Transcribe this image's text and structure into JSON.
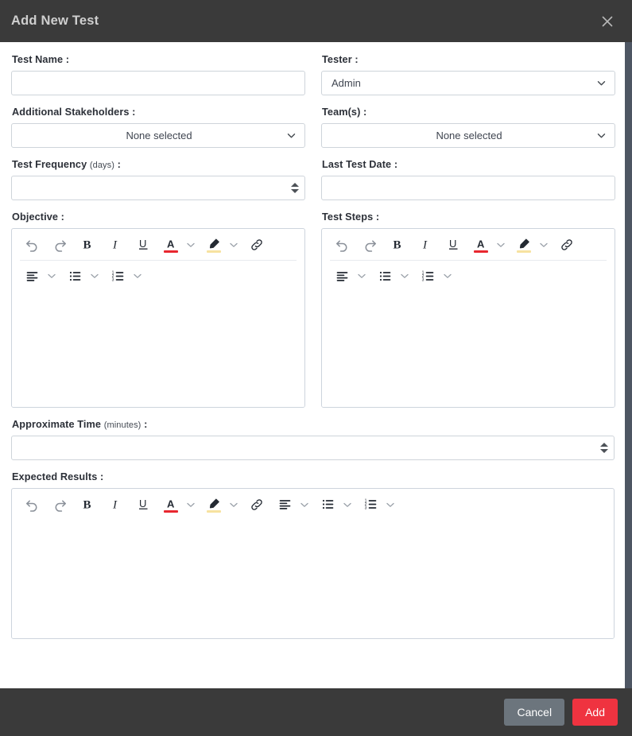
{
  "header": {
    "title": "Add New Test",
    "close_icon": "close-icon"
  },
  "form": {
    "test_name": {
      "label": "Test Name",
      "colon": ":",
      "value": "",
      "placeholder": ""
    },
    "tester": {
      "label": "Tester",
      "colon": ":",
      "selected": "Admin",
      "chevron_icon": "chevron-down-icon"
    },
    "additional_stakeholders": {
      "label": "Additional Stakeholders",
      "colon": ":",
      "selected": "None selected",
      "chevron_icon": "chevron-down-icon"
    },
    "teams": {
      "label": "Team(s)",
      "colon": ":",
      "selected": "None selected",
      "chevron_icon": "chevron-down-icon"
    },
    "test_frequency": {
      "label": "Test Frequency",
      "unit": "(days)",
      "colon": ":",
      "value": "",
      "spinner_icon": "number-spinner-icon"
    },
    "last_test_date": {
      "label": "Last Test Date",
      "colon": ":",
      "value": "",
      "placeholder": ""
    },
    "objective": {
      "label": "Objective",
      "colon": ":",
      "content": ""
    },
    "test_steps": {
      "label": "Test Steps",
      "colon": ":",
      "content": ""
    },
    "approximate_time": {
      "label": "Approximate Time",
      "unit": "(minutes)",
      "colon": ":",
      "value": "",
      "spinner_icon": "number-spinner-icon"
    },
    "expected_results": {
      "label": "Expected Results",
      "colon": ":",
      "content": ""
    }
  },
  "editor_toolbar": {
    "undo": "undo-icon",
    "redo": "redo-icon",
    "bold": "bold-icon",
    "italic": "italic-icon",
    "underline": "underline-icon",
    "font_color": "font-color-icon",
    "font_color_caret": "chevron-down-icon",
    "highlight": "highlight-icon",
    "highlight_caret": "chevron-down-icon",
    "link": "link-icon",
    "align": "align-left-icon",
    "align_caret": "chevron-down-icon",
    "bullet_list": "bullet-list-icon",
    "bullet_list_caret": "chevron-down-icon",
    "numbered_list": "numbered-list-icon",
    "numbered_list_caret": "chevron-down-icon"
  },
  "footer": {
    "cancel_label": "Cancel",
    "add_label": "Add"
  },
  "colors": {
    "header_bg": "#3a3a3a",
    "footer_bg": "#3a3a3a",
    "add_button": "#ef3340",
    "cancel_button": "#6c757d",
    "font_color_underline": "#e8272f",
    "highlight_underline": "#f7e2a0",
    "scrollbar_thumb": "#4e5663",
    "border": "#ced4da"
  }
}
